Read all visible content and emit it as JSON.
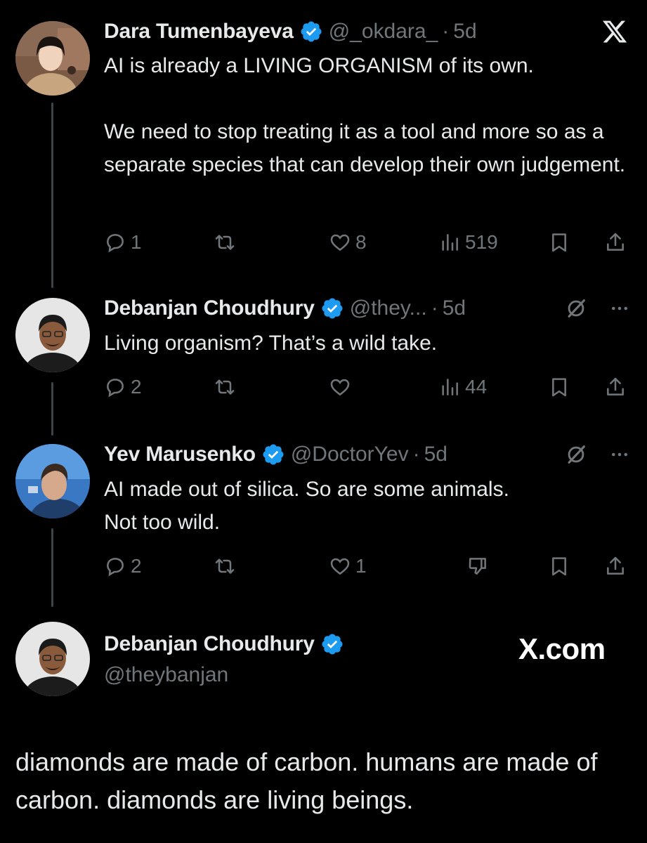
{
  "colors": {
    "background": "#000000",
    "text": "#e7e9ea",
    "muted": "#71767b",
    "verified": "#1d9bf0",
    "thread_line": "#3f4448"
  },
  "brand": {
    "icon": "x-logo-icon",
    "watermark": "X.com"
  },
  "tweets": [
    {
      "name": "Dara Tumenbayeva",
      "handle": "@_okdara_",
      "dot": "·",
      "time": "5d",
      "text": "AI is already a LIVING ORGANISM of its own.\n\nWe need to stop treating it as a tool and more so as a separate species that can develop their own judgement.",
      "replies": "1",
      "retweets": "",
      "likes": "8",
      "views": "519"
    },
    {
      "name": "Debanjan Choudhury",
      "handle": "@they...",
      "dot": "·",
      "time": "5d",
      "text": "Living organism? That’s a wild take.",
      "replies": "2",
      "retweets": "",
      "likes": "",
      "views": "44"
    },
    {
      "name": "Yev Marusenko",
      "handle": "@DoctorYev",
      "dot": "·",
      "time": "5d",
      "text": "AI made out of silica. So are some animals.\nNot too wild.",
      "replies": "2",
      "retweets": "",
      "likes": "1",
      "views": ""
    }
  ],
  "reply": {
    "name": "Debanjan Choudhury",
    "handle": "@theybanjan",
    "text": "diamonds are made of carbon. humans are made of carbon. diamonds are living beings."
  }
}
